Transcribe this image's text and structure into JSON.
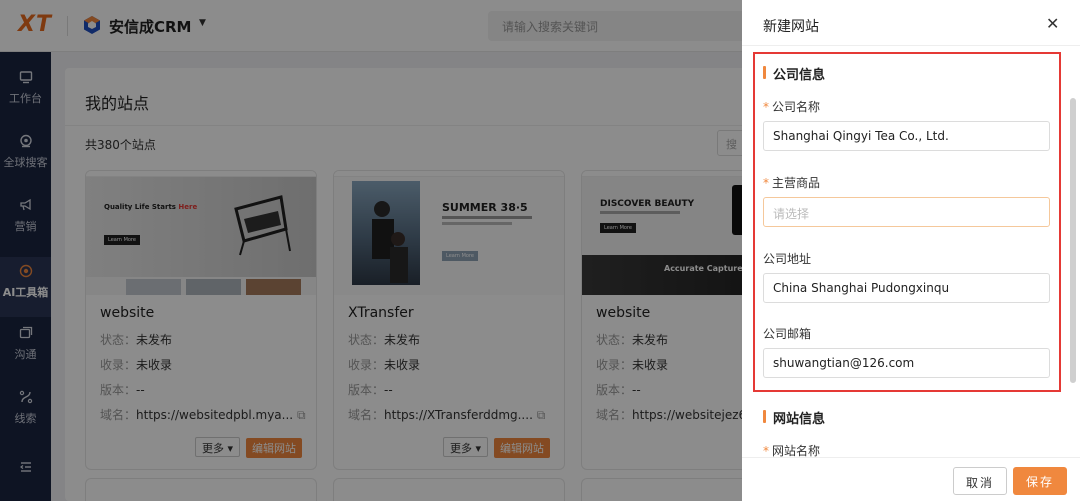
{
  "topbar": {
    "logo": "XT",
    "app_name": "安信成CRM",
    "search_placeholder": "请输入搜索关键词"
  },
  "sidebar": {
    "items": [
      {
        "label": "工作台",
        "icon": "monitor-icon"
      },
      {
        "label": "全球搜客",
        "icon": "globe-search-icon"
      },
      {
        "label": "营销",
        "icon": "megaphone-icon"
      },
      {
        "label": "AI工具箱",
        "icon": "ai-toolbox-icon",
        "active": true
      },
      {
        "label": "沟通",
        "icon": "chat-icon"
      },
      {
        "label": "线索",
        "icon": "clue-icon"
      }
    ]
  },
  "main": {
    "title": "我的站点",
    "count_prefix": "共",
    "count_value": "380",
    "count_suffix": "个站点",
    "search_placeholder": "搜",
    "meta_labels": {
      "status": "状态：",
      "indexed": "收录：",
      "version": "版本：",
      "domain": "域名："
    },
    "more_label": "更多",
    "edit_label": "编辑网站",
    "cards": [
      {
        "name": "website",
        "status": "未发布",
        "indexed": "未收录",
        "version": "--",
        "domain": "https://websitedpbl.mya...",
        "thumb_headline_1": "Quality Life Starts",
        "thumb_headline_2": "Here",
        "thumb_button": "Learn More"
      },
      {
        "name": "XTransfer",
        "status": "未发布",
        "indexed": "未收录",
        "version": "--",
        "domain": "https://XTransferddmg....",
        "thumb_headline_1": "SUMMER 38·5",
        "thumb_headline_2": "",
        "thumb_button": "Learn More"
      },
      {
        "name": "website",
        "status": "未发布",
        "indexed": "未收录",
        "version": "--",
        "domain": "https://websitejez6.",
        "thumb_headline_1": "DISCOVER BEAUTY",
        "thumb_headline_2": "Accurate Capture",
        "thumb_button": "Learn More"
      }
    ]
  },
  "drawer": {
    "title": "新建网站",
    "close_icon": "close-icon",
    "company_section": "公司信息",
    "fields": {
      "company_name": {
        "label": "公司名称",
        "required": true,
        "value": "Shanghai    Qingyi   Tea Co., Ltd."
      },
      "main_product": {
        "label": "主营商品",
        "required": true,
        "placeholder": "请选择"
      },
      "address": {
        "label": "公司地址",
        "required": false,
        "value": "China Shanghai Pudongxinqu"
      },
      "email": {
        "label": "公司邮箱",
        "required": false,
        "value": "shuwangtian@126.com"
      }
    },
    "website_section": "网站信息",
    "site_name_label": "网站名称",
    "cancel_label": "取消",
    "save_label": "保存"
  },
  "colors": {
    "accent": "#f0883e",
    "sidebar_bg": "#1a2541",
    "highlight": "#e53935"
  }
}
